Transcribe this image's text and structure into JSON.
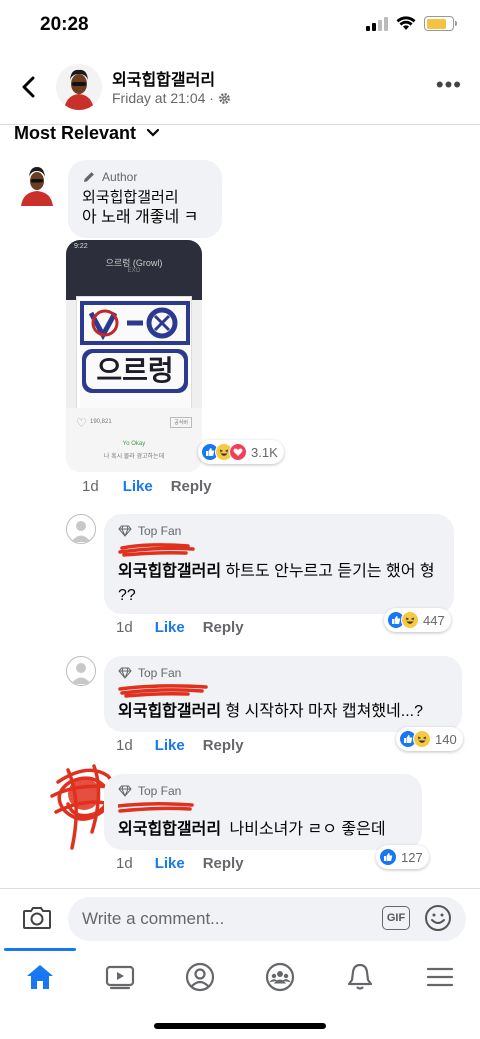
{
  "status": {
    "time": "20:28"
  },
  "header": {
    "title": "외국힙합갤러리",
    "subtitle": "Friday at 21:04 ·"
  },
  "sort": {
    "label": "Most Relevant"
  },
  "comments": [
    {
      "badge": "Author",
      "name": "외국힙합갤러리",
      "text": "아 노래 개좋네 ㅋ",
      "time": "1d",
      "like": "Like",
      "reply": "Reply",
      "reaction_count": "3.1K",
      "attachment": {
        "status_time": "9:22",
        "song": "으르렁 (Growl)",
        "artist": "EXO",
        "art_text": "으르렁",
        "likes": "190,821",
        "lyric_btn": "공식버",
        "caption_1": "Yo Okay",
        "caption_2": "나 혹시 몰라 경고하는데"
      }
    },
    {
      "badge": "Top Fan",
      "name": "외국힙합갤러리",
      "text": "하트도 안누르고 듣기는 했어 형 ??",
      "time": "1d",
      "like": "Like",
      "reply": "Reply",
      "reaction_count": "447"
    },
    {
      "badge": "Top Fan",
      "name": "외국힙합갤러리",
      "text": "형 시작하자 마자 캡쳐했네...?",
      "time": "1d",
      "like": "Like",
      "reply": "Reply",
      "reaction_count": "140"
    },
    {
      "badge": "Top Fan",
      "name": "외국힙합갤러리",
      "text": "나비소녀가 ㄹㅇ 좋은데",
      "time": "1d",
      "like": "Like",
      "reply": "Reply",
      "reaction_count": "127"
    }
  ],
  "composer": {
    "placeholder": "Write a comment...",
    "gif": "GIF"
  },
  "colors": {
    "accent": "#1877f2",
    "redaction": "#e0301e",
    "bubble": "#f0f2f5"
  }
}
